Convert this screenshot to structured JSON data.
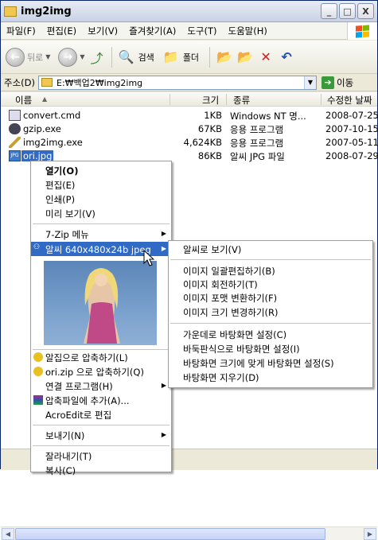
{
  "window": {
    "title": "img2img"
  },
  "titlebar_buttons": {
    "minimize": "_",
    "maximize": "□",
    "close": "X"
  },
  "menu": [
    "파일(F)",
    "편집(E)",
    "보기(V)",
    "즐겨찾기(A)",
    "도구(T)",
    "도움말(H)"
  ],
  "toolbar": {
    "back": "뒤로",
    "search": "검색",
    "folders": "폴더"
  },
  "address": {
    "label": "주소(D)",
    "path": "E:₩백업2₩img2img",
    "go": "이동"
  },
  "columns": {
    "name": "이름",
    "size": "크기",
    "type": "종류",
    "date": "수정한 날짜"
  },
  "files": [
    {
      "name": "convert.cmd",
      "size": "1KB",
      "type": "Windows NT 명...",
      "date": "2008-07-25"
    },
    {
      "name": "gzip.exe",
      "size": "67KB",
      "type": "응용 프로그램",
      "date": "2007-10-15"
    },
    {
      "name": "img2img.exe",
      "size": "4,624KB",
      "type": "응용 프로그램",
      "date": "2007-05-11"
    },
    {
      "name": "ori.jpg",
      "size": "86KB",
      "type": "알씨 JPG 파일",
      "date": "2008-07-29"
    }
  ],
  "context_menu": {
    "open": "열기(O)",
    "edit": "편집(E)",
    "print": "인쇄(P)",
    "preview": "미리 보기(V)",
    "zip7": "7-Zip 메뉴",
    "alsee": "알씨 640x480x24b jpeg",
    "alzip1": "알집으로 압축하기(L)",
    "alzip2": "ori.zip 으로 압축하기(Q)",
    "openwith": "연결 프로그램(H)",
    "addarchive": "압축파일에 추가(A)...",
    "acroedit": "AcroEdit로 편집",
    "sendto": "보내기(N)",
    "cut": "잘라내기(T)",
    "copy": "복사(C)"
  },
  "submenu": {
    "view": "알씨로 보기(V)",
    "batch": "이미지 일괄편집하기(B)",
    "rotate": "이미지 회전하기(T)",
    "format": "이미지 포맷 변환하기(F)",
    "resize": "이미지 크기 변경하기(R)",
    "center": "가운데로 바탕화면 설정(C)",
    "tile": "바둑판식으로 바탕화면 설정(I)",
    "stretch": "바탕화면 크기에 맞게 바탕화면 설정(S)",
    "clear": "바탕화면 지우기(D)"
  },
  "colors": {
    "selection": "#316ac5",
    "window_bg": "#ece9d8",
    "accent": "#0a246a"
  }
}
